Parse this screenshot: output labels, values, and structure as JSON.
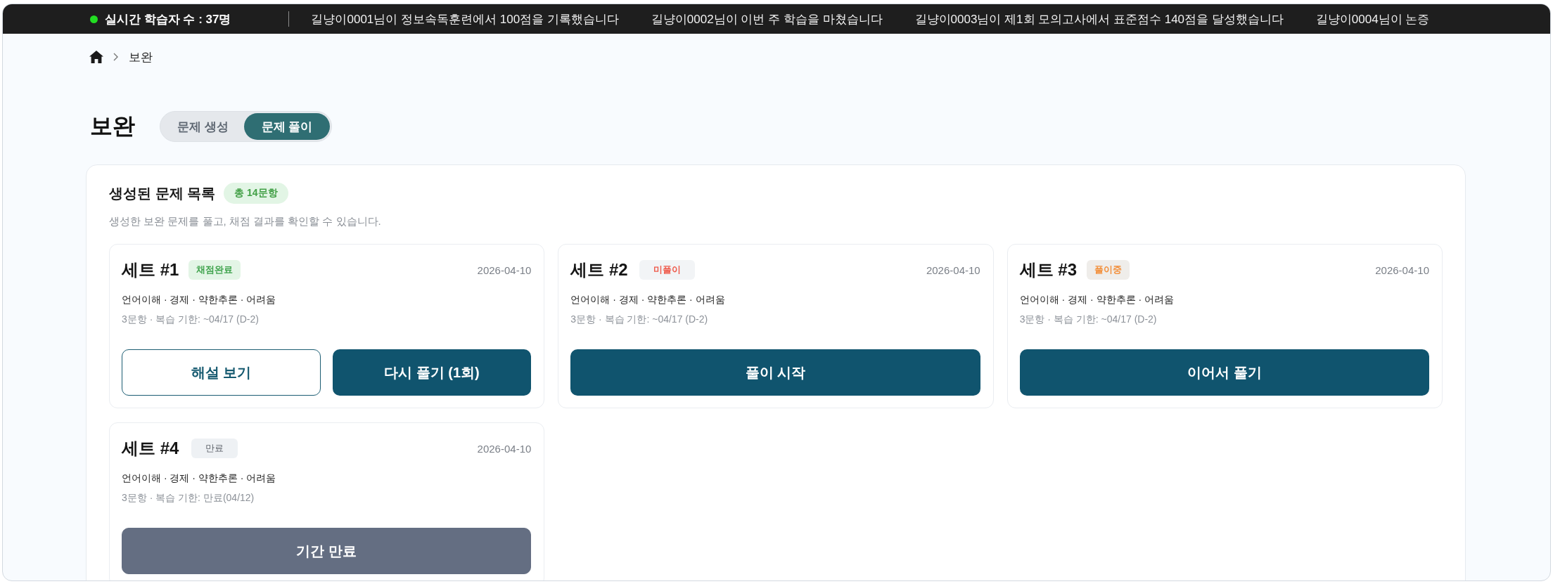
{
  "ticker": {
    "live_count": "실시간 학습자 수 : 37명",
    "messages": [
      "길냥이0001님이 정보속독훈련에서 100점을 기록했습니다",
      "길냥이0002님이 이번 주 학습을 마쳤습니다",
      "길냥이0003님이 제1회 모의고사에서 표준점수 140점을 달성했습니다",
      "길냥이0004님이 논증"
    ]
  },
  "breadcrumb": {
    "items": [
      "보완"
    ]
  },
  "page": {
    "title": "보완",
    "tabs": [
      {
        "label": "문제 생성",
        "selected": false
      },
      {
        "label": "문제 풀이",
        "selected": true
      }
    ]
  },
  "problem_list": {
    "title": "생성된 문제 목록",
    "count_badge": "총 14문항",
    "description": "생성한 보완 문제를 풀고, 채점 결과를 확인할 수 있습니다.",
    "sets": [
      {
        "title": "세트 #1",
        "status": {
          "label": "채점완료",
          "kind": "graded"
        },
        "date": "2026-04-10",
        "meta": "언어이해 · 경제 · 약한추론 · 어려움",
        "info": "3문항 · 복습 기한: ~04/17 (D-2)",
        "buttons": [
          {
            "label": "해설 보기",
            "kind": "outline",
            "disabled": false
          },
          {
            "label": "다시 풀기 (1회)",
            "kind": "primary",
            "disabled": false
          }
        ]
      },
      {
        "title": "세트 #2",
        "status": {
          "label": "미풀이",
          "kind": "unsolved"
        },
        "date": "2026-04-10",
        "meta": "언어이해 · 경제 · 약한추론 · 어려움",
        "info": "3문항 · 복습 기한: ~04/17 (D-2)",
        "buttons": [
          {
            "label": "풀이 시작",
            "kind": "primary",
            "disabled": false
          }
        ]
      },
      {
        "title": "세트 #3",
        "status": {
          "label": "풀이중",
          "kind": "in_progress"
        },
        "date": "2026-04-10",
        "meta": "언어이해 · 경제 · 약한추론 · 어려움",
        "info": "3문항 · 복습 기한: ~04/17 (D-2)",
        "buttons": [
          {
            "label": "이어서 풀기",
            "kind": "primary",
            "disabled": false
          }
        ]
      },
      {
        "title": "세트 #4",
        "status": {
          "label": "만료",
          "kind": "expired"
        },
        "date": "2026-04-10",
        "meta": "언어이해 · 경제 · 약한추론 · 어려움",
        "info": "3문항 · 복습 기한: 만료(04/12)",
        "buttons": [
          {
            "label": "기간 만료",
            "kind": "primary",
            "disabled": true
          }
        ]
      }
    ]
  }
}
